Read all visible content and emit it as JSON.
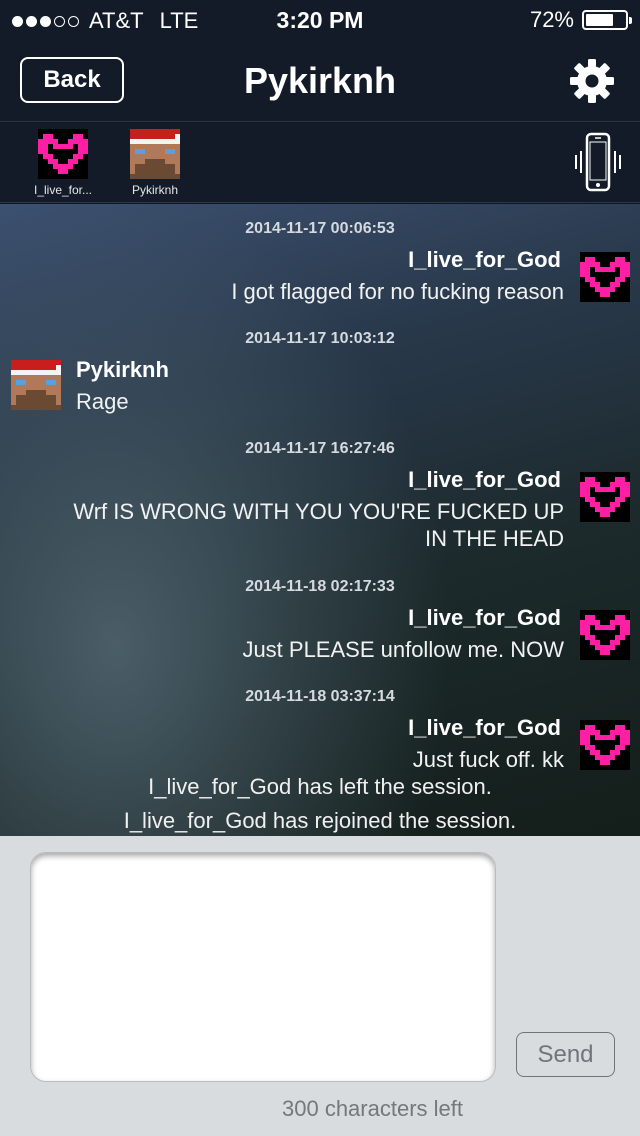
{
  "status_bar": {
    "carrier": "AT&T",
    "network": "LTE",
    "signal_bars_filled": 3,
    "signal_bars_total": 5,
    "time": "3:20 PM",
    "battery_text": "72%",
    "battery_level": 0.72
  },
  "nav": {
    "back_label": "Back",
    "title": "Pykirknh",
    "settings_icon": "gear-icon"
  },
  "participants": [
    {
      "name": "I_live_for...",
      "avatar": "pink-heart-avatar"
    },
    {
      "name": "Pykirknh",
      "avatar": "santa-hat-avatar"
    }
  ],
  "vibrate_icon": "phone-vibrate-icon",
  "messages": [
    {
      "timestamp": "2014-11-17 00:06:53",
      "sender": "I_live_for_God",
      "text": "I  got flagged for no fucking reason",
      "side": "right"
    },
    {
      "timestamp": "2014-11-17 10:03:12",
      "sender": "Pykirknh",
      "text": "Rage",
      "side": "left"
    },
    {
      "timestamp": "2014-11-17 16:27:46",
      "sender": "I_live_for_God",
      "text_lines": [
        "Wrf IS WRONG WITH YOU YOU'RE FUCKED UP",
        "IN THE HEAD"
      ],
      "side": "right"
    },
    {
      "timestamp": "2014-11-18 02:17:33",
      "sender": "I_live_for_God",
      "text": "Just PLEASE unfollow me. NOW",
      "side": "right"
    },
    {
      "timestamp": "2014-11-18 03:37:14",
      "sender": "I_live_for_God",
      "text": "Just fuck off.  kk",
      "side": "right"
    }
  ],
  "system_messages": [
    "I_live_for_God has left the session.",
    "I_live_for_God has rejoined the session."
  ],
  "composer": {
    "input_value": "",
    "input_placeholder": "",
    "send_label": "Send",
    "char_counter": "300 characters left"
  },
  "colors": {
    "heart_pink": "#ff1fa4",
    "heart_black": "#000000",
    "santa_red": "#c81e1e",
    "skin": "#b07a5a"
  }
}
